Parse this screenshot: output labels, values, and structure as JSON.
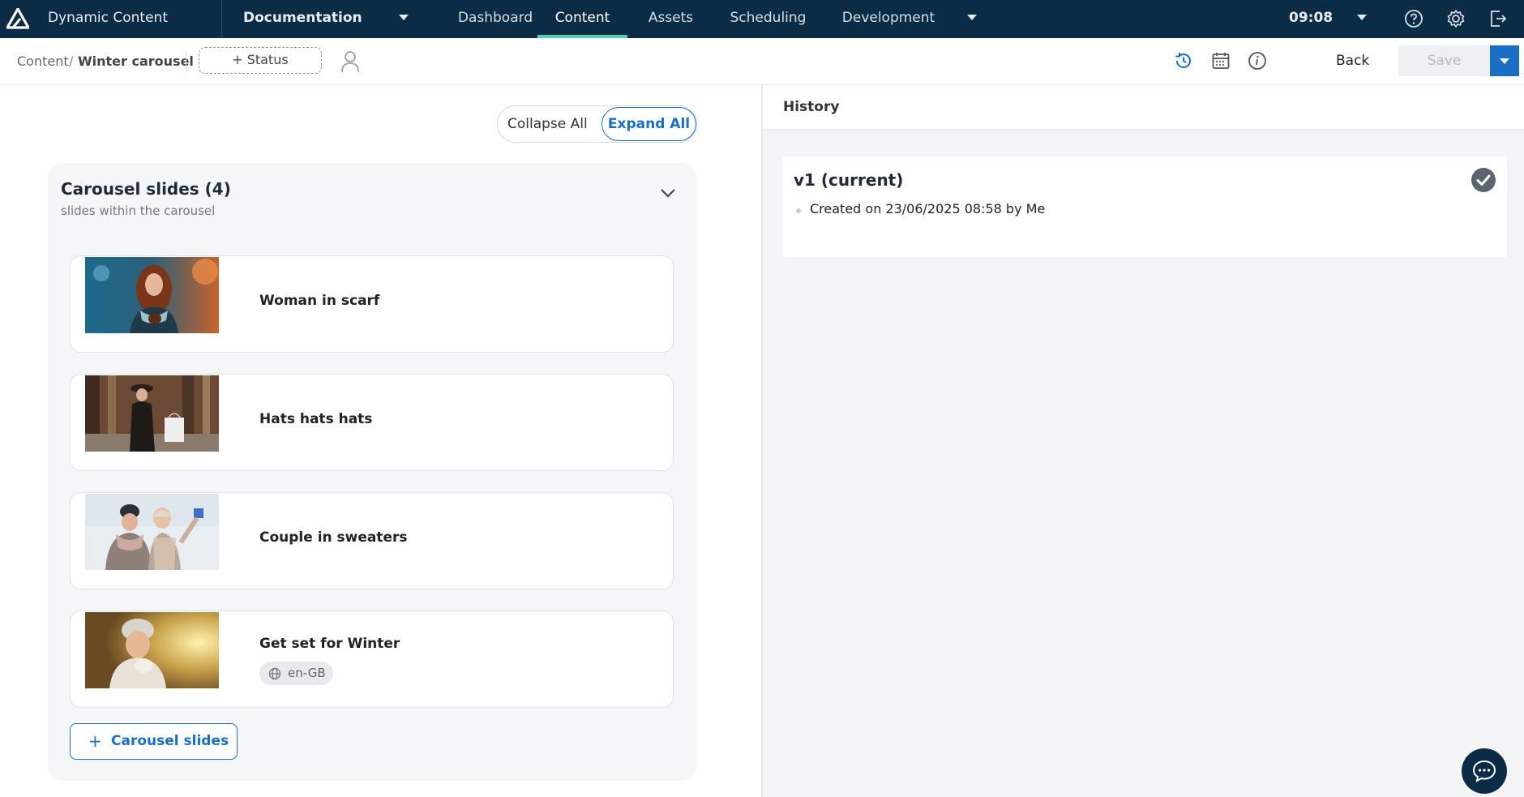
{
  "app": {
    "name": "Dynamic Content",
    "hub": "Documentation",
    "clock": "09:08"
  },
  "nav": {
    "tabs": [
      "Dashboard",
      "Content",
      "Assets",
      "Scheduling",
      "Development"
    ],
    "active": "Content"
  },
  "toolbar": {
    "breadcrumb_root": "Content",
    "breadcrumb_sep": "/",
    "breadcrumb_current": "Winter carousel",
    "status_label": "+ Status",
    "back_label": "Back",
    "save_label": "Save"
  },
  "editor": {
    "collapse_label": "Collapse All",
    "expand_label": "Expand All",
    "section_title": "Carousel slides (4)",
    "section_subtitle": "slides within the carousel",
    "slides": [
      {
        "label": "Woman in scarf",
        "thumb_icon": "photo-woman-scarf"
      },
      {
        "label": "Hats hats hats",
        "thumb_icon": "photo-hats"
      },
      {
        "label": "Couple in sweaters",
        "thumb_icon": "photo-couple"
      },
      {
        "label": "Get set for Winter",
        "thumb_icon": "photo-winter",
        "locale": "en-GB"
      }
    ],
    "add_label": "Carousel slides"
  },
  "history": {
    "title": "History",
    "version_title": "v1 (current)",
    "created_text": "Created on 23/06/2025 08:58 by Me"
  },
  "colors": {
    "nav_bg": "#0c2b45",
    "accent": "#1a6fc4",
    "active_tab_underline": "#4fd1b1"
  }
}
